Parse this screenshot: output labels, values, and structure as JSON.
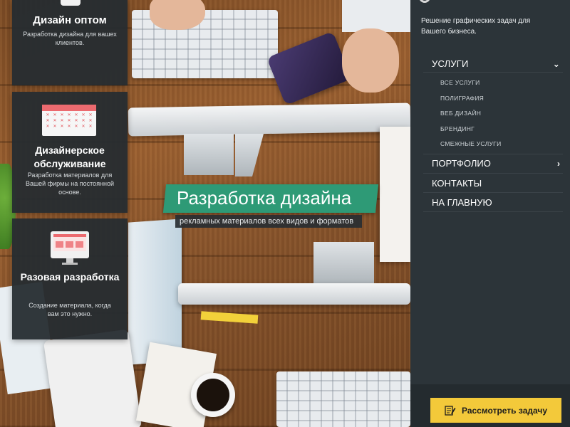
{
  "cards": [
    {
      "title": "Дизайн оптом",
      "description": "Разработка дизайна для вашех клиентов.",
      "icon": "tablet-icon"
    },
    {
      "title": "Дизайнерское обслуживание",
      "description": "Разработка материалов для Вашей фирмы на постоянной основе.",
      "icon": "calendar-icon"
    },
    {
      "title": "Разовая разработка",
      "description": "Создание материала, когда вам это нужно.",
      "icon": "monitor-icon"
    }
  ],
  "banner": {
    "headline": "Разработка дизайна",
    "subheadline": "рекламных материалов всех видов и форматов"
  },
  "sidebar": {
    "tagline": "Решение графических задач для Вашего бизнеса.",
    "nav": {
      "services": "УСЛУГИ",
      "services_sub": [
        "ВСЕ УСЛУГИ",
        "ПОЛИГРАФИЯ",
        "ВЕБ ДИЗАЙН",
        "БРЕНДИНГ",
        "СМЕЖНЫЕ УСЛУГИ"
      ],
      "portfolio": "ПОРТФОЛИО",
      "contacts": "КОНТАКТЫ",
      "home": "НА ГЛАВНУЮ"
    },
    "cta_label": "Рассмотреть задачу"
  },
  "colors": {
    "accent_green": "#2e9a76",
    "accent_yellow": "#f3c93a",
    "accent_red": "#ec6a6f",
    "sidebar_bg": "#2c3439",
    "card_bg": "#262c30"
  }
}
